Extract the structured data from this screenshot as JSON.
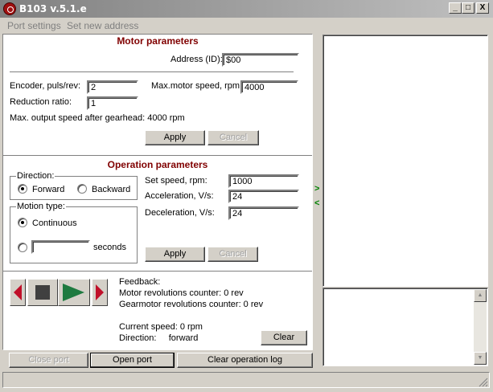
{
  "window": {
    "title": "B103 v.5.1.e",
    "minimize": "_",
    "maximize": "□",
    "close": "X"
  },
  "menu": {
    "port_settings": "Port settings",
    "set_new_address": "Set new address"
  },
  "motor": {
    "header": "Motor parameters",
    "address_label": "Address (ID):",
    "address_value": "$00",
    "encoder_label": "Encoder, puls/rev:",
    "encoder_value": "2",
    "max_speed_label": "Max.motor speed, rpm:",
    "max_speed_value": "4000",
    "reduction_label": "Reduction ratio:",
    "reduction_value": "1",
    "max_output_text": "Max. output speed after gearhead: 4000 rpm",
    "apply": "Apply",
    "cancel": "Cancel"
  },
  "operation": {
    "header": "Operation parameters",
    "direction_label": "Direction:",
    "forward": "Forward",
    "backward": "Backward",
    "motion_label": "Motion type:",
    "continuous": "Continuous",
    "seconds": "seconds",
    "seconds_value": "",
    "set_speed_label": "Set speed, rpm:",
    "set_speed_value": "1000",
    "accel_label": "Acceleration, V/s:",
    "accel_value": "24",
    "decel_label": "Deceleration, V/s:",
    "decel_value": "24",
    "apply": "Apply",
    "cancel": "Cancel"
  },
  "feedback": {
    "title": "Feedback:",
    "motor_counter": "Motor revolutions counter: 0 rev",
    "gearmotor_counter": "Gearmotor revolutions counter: 0 rev",
    "current_speed": "Current speed: 0 rpm",
    "direction": "Direction:     forward",
    "clear": "Clear"
  },
  "bottom": {
    "close_port": "Close port",
    "open_port": "Open port",
    "clear_log": "Clear operation log"
  },
  "splitter": {
    "right_arrow": ">",
    "left_arrow": "<"
  },
  "colors": {
    "header": "#800000",
    "play": "#1e7a40",
    "arrows": "#c0102a"
  }
}
